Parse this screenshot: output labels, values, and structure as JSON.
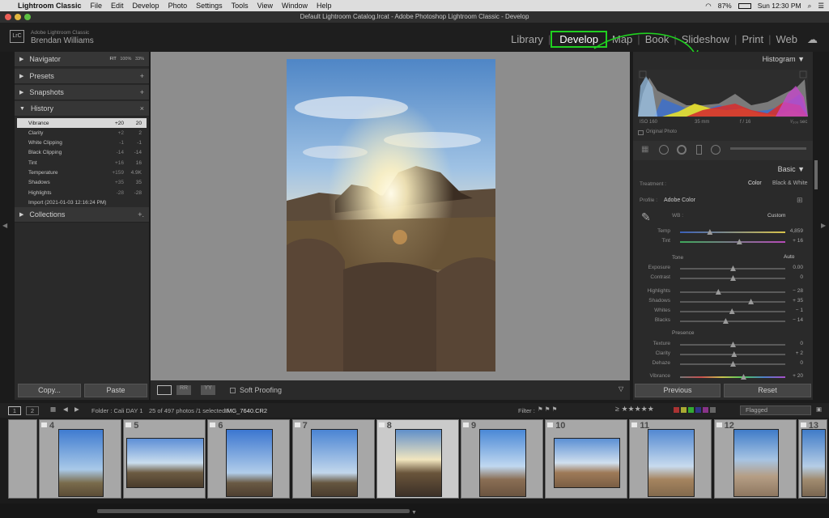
{
  "menubar": {
    "apple": "",
    "items": [
      "Lightroom Classic",
      "File",
      "Edit",
      "Develop",
      "Photo",
      "Settings",
      "Tools",
      "View",
      "Window",
      "Help"
    ],
    "battery": "87%",
    "clock": "Sun 12:30 PM"
  },
  "window": {
    "title": "Default Lightroom Catalog.lrcat - Adobe Photoshop Lightroom Classic - Develop"
  },
  "identity": {
    "logo": "LrC",
    "product": "Adobe Lightroom Classic",
    "user": "Brendan Williams"
  },
  "modules": [
    "Library",
    "Develop",
    "Map",
    "Book",
    "Slideshow",
    "Print",
    "Web"
  ],
  "active_module": "Develop",
  "left": {
    "navigator": {
      "label": "Navigator",
      "zoom": [
        "FIT",
        "100%",
        "33%"
      ]
    },
    "presets": "Presets",
    "snapshots": "Snapshots",
    "history": {
      "label": "History",
      "items": [
        {
          "name": "Vibrance",
          "a": "+20",
          "b": "20"
        },
        {
          "name": "Clarity",
          "a": "+2",
          "b": "2"
        },
        {
          "name": "White Clipping",
          "a": "-1",
          "b": "-1"
        },
        {
          "name": "Black Clipping",
          "a": "-14",
          "b": "-14"
        },
        {
          "name": "Tint",
          "a": "+16",
          "b": "16"
        },
        {
          "name": "Temperature",
          "a": "+159",
          "b": "4.9K"
        },
        {
          "name": "Shadows",
          "a": "+35",
          "b": "35"
        },
        {
          "name": "Highlights",
          "a": "-28",
          "b": "-28"
        },
        {
          "name": "Import (2021-01-03 12:16:24 PM)",
          "a": "",
          "b": ""
        }
      ]
    },
    "collections": "Collections",
    "copy": "Copy...",
    "paste": "Paste"
  },
  "toolbar": {
    "soft_proofing": "Soft Proofing"
  },
  "right": {
    "histogram": {
      "label": "Histogram",
      "iso": "ISO 160",
      "focal": "35 mm",
      "aperture": "f / 16",
      "shutter": "¹⁄₂₀₀ sec",
      "original": "Original Photo"
    },
    "basic": {
      "label": "Basic",
      "treatment_label": "Treatment :",
      "treatment": [
        "Color",
        "Black & White"
      ],
      "profile_label": "Profile :",
      "profile": "Adobe Color",
      "wb_label": "WB :",
      "wb": "Custom",
      "tone": "Tone",
      "auto": "Auto",
      "presence": "Presence",
      "sliders": [
        {
          "label": "Temp",
          "value": "4,859",
          "pos": 0.28
        },
        {
          "label": "Tint",
          "value": "+ 16",
          "pos": 0.56
        },
        {
          "label": "Exposure",
          "value": "0.00",
          "pos": 0.5
        },
        {
          "label": "Contrast",
          "value": "0",
          "pos": 0.5
        },
        {
          "label": "Highlights",
          "value": "− 28",
          "pos": 0.36
        },
        {
          "label": "Shadows",
          "value": "+ 35",
          "pos": 0.67
        },
        {
          "label": "Whites",
          "value": "− 1",
          "pos": 0.49
        },
        {
          "label": "Blacks",
          "value": "− 14",
          "pos": 0.43
        },
        {
          "label": "Texture",
          "value": "0",
          "pos": 0.5
        },
        {
          "label": "Clarity",
          "value": "+ 2",
          "pos": 0.51
        },
        {
          "label": "Dehaze",
          "value": "0",
          "pos": 0.5
        },
        {
          "label": "Vibrance",
          "value": "+ 20",
          "pos": 0.6
        }
      ]
    },
    "previous": "Previous",
    "reset": "Reset"
  },
  "filmbar": {
    "pages": [
      "1",
      "2"
    ],
    "folder": "Folder : Cali DAY 1",
    "count": "25 of 497 photos /1 selected /",
    "file": "IMG_7640.CR2",
    "filter_label": "Filter :",
    "filter": "Flagged"
  },
  "filmstrip": [
    "4",
    "5",
    "6",
    "7",
    "8",
    "9",
    "10",
    "11",
    "12",
    "13"
  ],
  "selected_frame": "8"
}
